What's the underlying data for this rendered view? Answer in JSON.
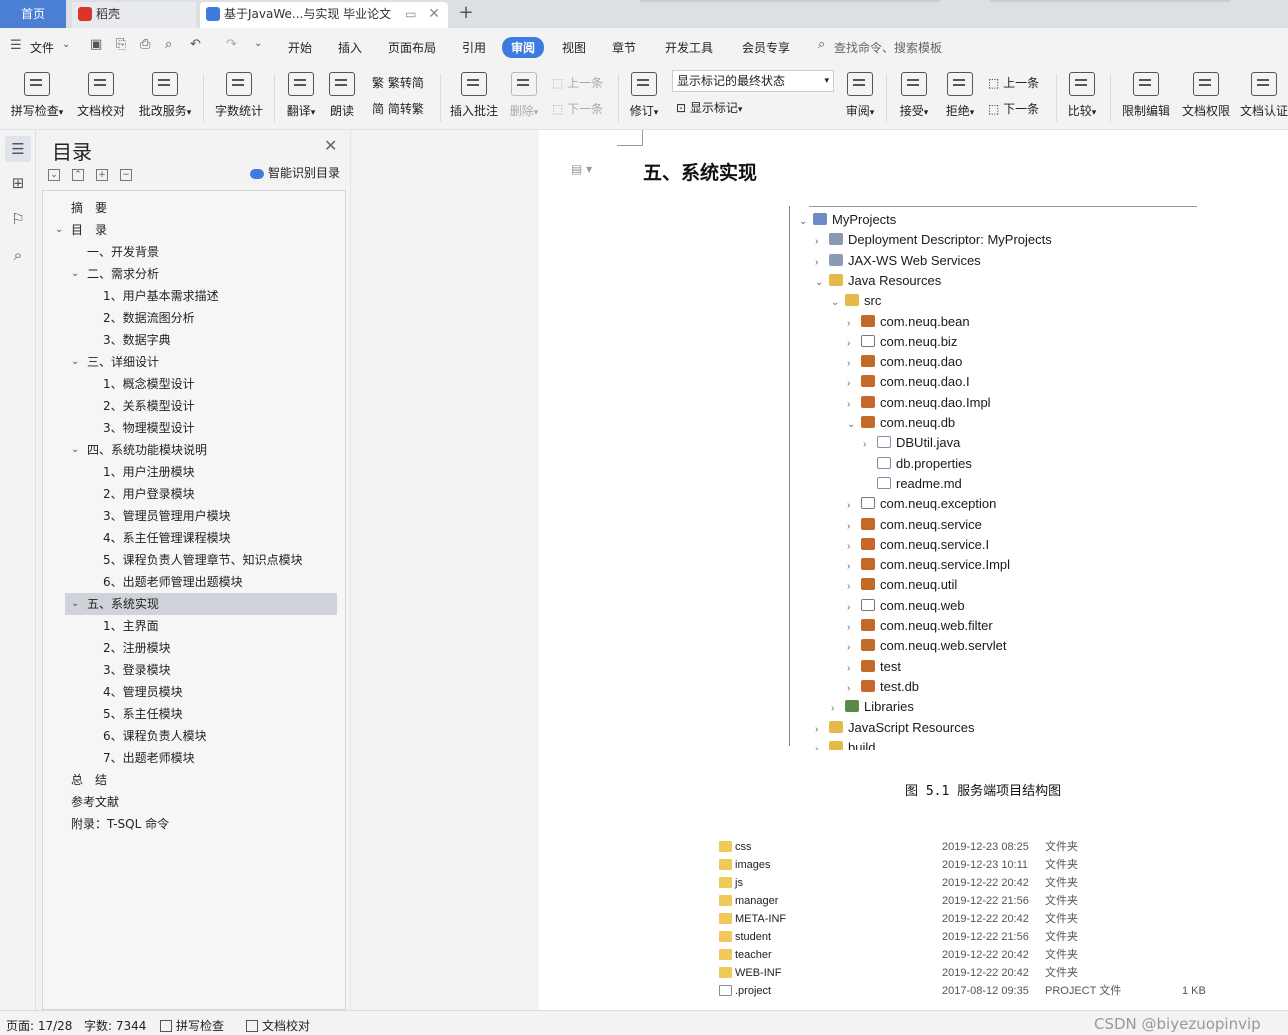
{
  "tabs": {
    "home": "首页",
    "daoke": "稻壳",
    "document": "基于JavaWe...与实现 毕业论文"
  },
  "menu": {
    "file": "文件",
    "items": [
      "开始",
      "插入",
      "页面布局",
      "引用",
      "审阅",
      "视图",
      "章节",
      "开发工具",
      "会员专享"
    ],
    "active": "审阅",
    "search": "查找命令、搜索模板"
  },
  "ribbon": {
    "spellcheck": "拼写检查",
    "proofread": "文档校对",
    "batch": "批改服务",
    "wordcount": "字数统计",
    "translate": "翻译",
    "read": "朗读",
    "to_simplified": "繁转简",
    "to_traditional": "简转繁",
    "insert_comment": "插入批注",
    "delete": "删除",
    "prev": "上一条",
    "next": "下一条",
    "revise": "修订",
    "markup_select": "显示标记的最终状态",
    "show_markup": "显示标记",
    "review": "审阅",
    "accept": "接受",
    "reject": "拒绝",
    "prev2": "上一条",
    "next2": "下一条",
    "compare": "比较",
    "restrict": "限制编辑",
    "rights": "文档权限",
    "certify": "文档认证"
  },
  "toc": {
    "title": "目录",
    "smart": "智能识别目录",
    "items": [
      {
        "label": "摘　要",
        "level": 1,
        "chevron": ""
      },
      {
        "label": "目　录",
        "level": 1,
        "chevron": "v"
      },
      {
        "label": "一、开发背景",
        "level": 2,
        "chevron": ""
      },
      {
        "label": "二、需求分析",
        "level": 2,
        "chevron": "v"
      },
      {
        "label": "1、用户基本需求描述",
        "level": 3,
        "chevron": ""
      },
      {
        "label": "2、数据流图分析",
        "level": 3,
        "chevron": ""
      },
      {
        "label": "3、数据字典",
        "level": 3,
        "chevron": ""
      },
      {
        "label": "三、详细设计",
        "level": 2,
        "chevron": "v"
      },
      {
        "label": "1、概念模型设计",
        "level": 3,
        "chevron": ""
      },
      {
        "label": "2、关系模型设计",
        "level": 3,
        "chevron": ""
      },
      {
        "label": "3、物理模型设计",
        "level": 3,
        "chevron": ""
      },
      {
        "label": "四、系统功能模块说明",
        "level": 2,
        "chevron": "v"
      },
      {
        "label": "1、用户注册模块",
        "level": 3,
        "chevron": ""
      },
      {
        "label": "2、用户登录模块",
        "level": 3,
        "chevron": ""
      },
      {
        "label": "3、管理员管理用户模块",
        "level": 3,
        "chevron": ""
      },
      {
        "label": "4、系主任管理课程模块",
        "level": 3,
        "chevron": ""
      },
      {
        "label": "5、课程负责人管理章节、知识点模块",
        "level": 3,
        "chevron": ""
      },
      {
        "label": "6、出题老师管理出题模块",
        "level": 3,
        "chevron": ""
      },
      {
        "label": "五、系统实现",
        "level": 2,
        "chevron": "v",
        "selected": true
      },
      {
        "label": "1、主界面",
        "level": 3,
        "chevron": ""
      },
      {
        "label": "2、注册模块",
        "level": 3,
        "chevron": ""
      },
      {
        "label": "3、登录模块",
        "level": 3,
        "chevron": ""
      },
      {
        "label": "4、管理员模块",
        "level": 3,
        "chevron": ""
      },
      {
        "label": "5、系主任模块",
        "level": 3,
        "chevron": ""
      },
      {
        "label": "6、课程负责人模块",
        "level": 3,
        "chevron": ""
      },
      {
        "label": "7、出题老师模块",
        "level": 3,
        "chevron": ""
      },
      {
        "label": "总　结",
        "level": 1,
        "chevron": ""
      },
      {
        "label": "参考文献",
        "level": 1,
        "chevron": ""
      },
      {
        "label": "附录：T-SQL 命令",
        "level": 1,
        "chevron": ""
      }
    ]
  },
  "document": {
    "heading": "五、系统实现",
    "caption": "图 5.1 服务端项目结构图",
    "tree": [
      {
        "label": "MyProjects",
        "depth": 0,
        "chevron": "v",
        "icon": "proj"
      },
      {
        "label": "Deployment Descriptor: MyProjects",
        "depth": 1,
        "chevron": ">",
        "icon": "gear"
      },
      {
        "label": "JAX-WS Web Services",
        "depth": 1,
        "chevron": ">",
        "icon": "gear"
      },
      {
        "label": "Java Resources",
        "depth": 1,
        "chevron": "v",
        "icon": "folder"
      },
      {
        "label": "src",
        "depth": 2,
        "chevron": "v",
        "icon": "folder"
      },
      {
        "label": "com.neuq.bean",
        "depth": 3,
        "chevron": ">",
        "icon": "pkg"
      },
      {
        "label": "com.neuq.biz",
        "depth": 3,
        "chevron": ">",
        "icon": "pkgempty"
      },
      {
        "label": "com.neuq.dao",
        "depth": 3,
        "chevron": ">",
        "icon": "pkg"
      },
      {
        "label": "com.neuq.dao.I",
        "depth": 3,
        "chevron": ">",
        "icon": "pkg"
      },
      {
        "label": "com.neuq.dao.Impl",
        "depth": 3,
        "chevron": ">",
        "icon": "pkg"
      },
      {
        "label": "com.neuq.db",
        "depth": 3,
        "chevron": "v",
        "icon": "pkg"
      },
      {
        "label": "DBUtil.java",
        "depth": 4,
        "chevron": ">",
        "icon": "file"
      },
      {
        "label": "db.properties",
        "depth": 4,
        "chevron": "",
        "icon": "file"
      },
      {
        "label": "readme.md",
        "depth": 4,
        "chevron": "",
        "icon": "file"
      },
      {
        "label": "com.neuq.exception",
        "depth": 3,
        "chevron": ">",
        "icon": "pkgempty"
      },
      {
        "label": "com.neuq.service",
        "depth": 3,
        "chevron": ">",
        "icon": "pkg"
      },
      {
        "label": "com.neuq.service.I",
        "depth": 3,
        "chevron": ">",
        "icon": "pkg"
      },
      {
        "label": "com.neuq.service.Impl",
        "depth": 3,
        "chevron": ">",
        "icon": "pkg"
      },
      {
        "label": "com.neuq.util",
        "depth": 3,
        "chevron": ">",
        "icon": "pkg"
      },
      {
        "label": "com.neuq.web",
        "depth": 3,
        "chevron": ">",
        "icon": "pkgempty"
      },
      {
        "label": "com.neuq.web.filter",
        "depth": 3,
        "chevron": ">",
        "icon": "pkg"
      },
      {
        "label": "com.neuq.web.servlet",
        "depth": 3,
        "chevron": ">",
        "icon": "pkg"
      },
      {
        "label": "test",
        "depth": 3,
        "chevron": ">",
        "icon": "pkg"
      },
      {
        "label": "test.db",
        "depth": 3,
        "chevron": ">",
        "icon": "pkg"
      },
      {
        "label": "Libraries",
        "depth": 2,
        "chevron": ">",
        "icon": "lib"
      },
      {
        "label": "JavaScript Resources",
        "depth": 1,
        "chevron": ">",
        "icon": "folder"
      },
      {
        "label": "build",
        "depth": 1,
        "chevron": ">",
        "icon": "folder"
      }
    ],
    "files": [
      {
        "name": "css",
        "date": "2019-12-23 08:25",
        "type": "文件夹",
        "size": "",
        "kind": "folder"
      },
      {
        "name": "images",
        "date": "2019-12-23 10:11",
        "type": "文件夹",
        "size": "",
        "kind": "folder"
      },
      {
        "name": "js",
        "date": "2019-12-22 20:42",
        "type": "文件夹",
        "size": "",
        "kind": "folder"
      },
      {
        "name": "manager",
        "date": "2019-12-22 21:56",
        "type": "文件夹",
        "size": "",
        "kind": "folder"
      },
      {
        "name": "META-INF",
        "date": "2019-12-22 20:42",
        "type": "文件夹",
        "size": "",
        "kind": "folder"
      },
      {
        "name": "student",
        "date": "2019-12-22 21:56",
        "type": "文件夹",
        "size": "",
        "kind": "folder"
      },
      {
        "name": "teacher",
        "date": "2019-12-22 20:42",
        "type": "文件夹",
        "size": "",
        "kind": "folder"
      },
      {
        "name": "WEB-INF",
        "date": "2019-12-22 20:42",
        "type": "文件夹",
        "size": "",
        "kind": "folder"
      },
      {
        "name": ".project",
        "date": "2017-08-12 09:35",
        "type": "PROJECT 文件",
        "size": "1 KB",
        "kind": "doc"
      }
    ]
  },
  "status": {
    "page": "页面: 17/28",
    "words": "字数: 7344",
    "spellcheck": "拼写检查",
    "proofread": "文档校对",
    "watermark": "CSDN @biyezuopinvip"
  }
}
